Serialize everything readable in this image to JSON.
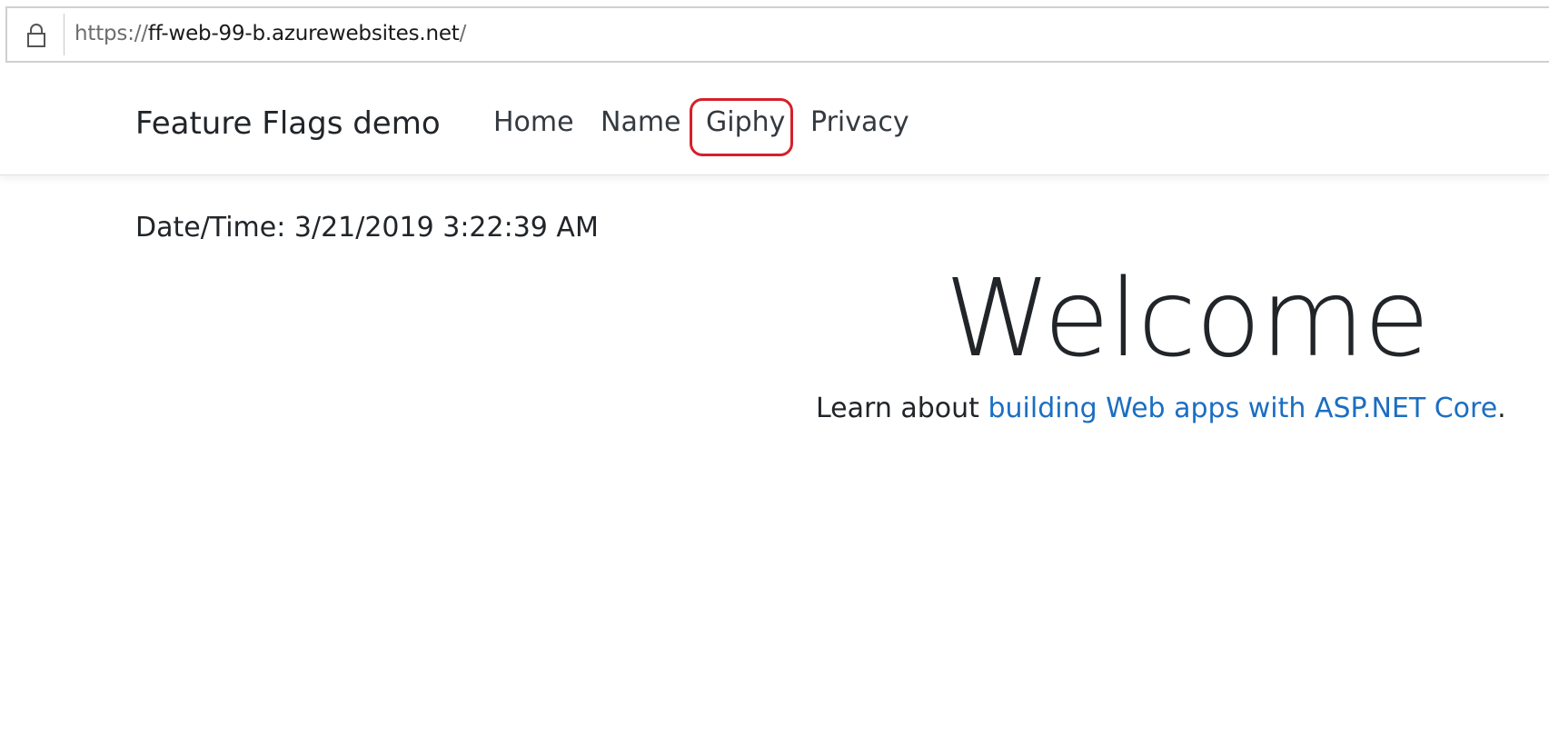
{
  "browser": {
    "url_scheme": "https://",
    "url_host": "ff-web-99-b.azurewebsites.net",
    "url_path": "/",
    "lock_icon": "lock-icon"
  },
  "navbar": {
    "brand": "Feature Flags demo",
    "items": [
      {
        "label": "Home"
      },
      {
        "label": "Name"
      },
      {
        "label": "Giphy",
        "highlighted": true,
        "highlight_color": "#d6202a"
      },
      {
        "label": "Privacy"
      }
    ]
  },
  "main": {
    "datetime": "Date/Time: 3/21/2019 3:22:39 AM",
    "heading": "Welcome",
    "learn_prefix": "Learn about ",
    "learn_link": "building Web apps with ASP.NET Core",
    "learn_suffix": ".",
    "link_color": "#1b6ec2"
  }
}
